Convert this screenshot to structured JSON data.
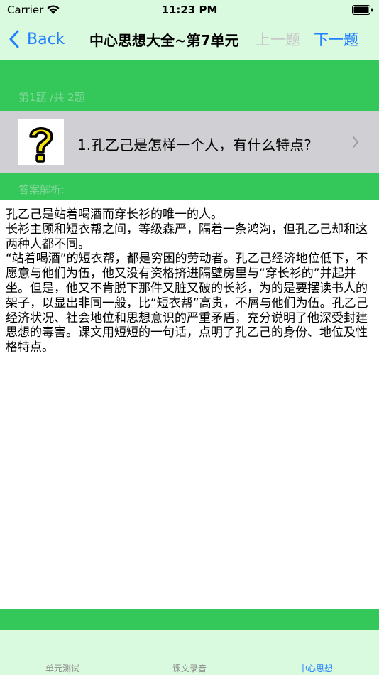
{
  "status_bar": {
    "carrier": "Carrier",
    "time": "11:23 PM"
  },
  "nav": {
    "back_label": "Back",
    "title": "中心思想大全~第7单元",
    "prev_label": "上一题",
    "next_label": "下一题"
  },
  "question": {
    "counter": "第1题 /共 2题",
    "text": "1.孔乙己是怎样一个人，有什么特点?"
  },
  "answer": {
    "label": "答案解析:",
    "paragraphs": [
      "孔乙己是站着喝酒而穿长衫的唯一的人。",
      "长衫主顾和短衣帮之间，等级森严，隔着一条鸿沟，但孔乙己却和这两种人都不同。",
      "“站着喝酒”的短衣帮，都是穷困的劳动者。孔乙己经济地位低下，不愿意与他们为伍，他又没有资格挤进隔壁房里与“穿长衫的”并起并坐。但是，他又不肯脱下那件又脏又破的长衫，为的是要摆读书人的架子，以显出非同一般，比“短衣帮”高贵，不屑与他们为伍。孔乙己经济状况、社会地位和思想意识的严重矛盾，充分说明了他深受封建思想的毒害。课文用短短的一句话，点明了孔乙己的身份、地位及性格特点。"
    ]
  },
  "tabs": [
    {
      "label": "单元测试"
    },
    {
      "label": "课文录音"
    },
    {
      "label": "中心思想"
    }
  ],
  "colors": {
    "accent": "#1f7fff",
    "green": "#34c759",
    "light_green": "#dafadf"
  }
}
